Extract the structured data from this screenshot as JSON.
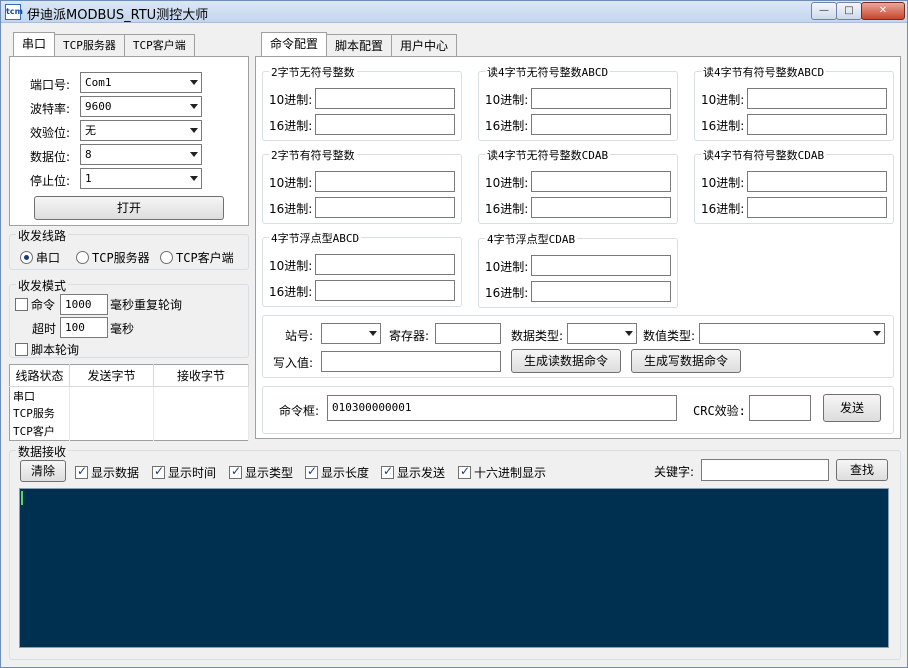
{
  "window": {
    "icon": "tcm-app-icon",
    "title": "伊迪派MODBUS_RTU测控大师",
    "buttons": {
      "minimize": "—",
      "maximize": "□",
      "close": "✕"
    }
  },
  "left_tabs": [
    "串口",
    "TCP服务器",
    "TCP客户端"
  ],
  "serial": {
    "port_label": "端口号:",
    "port_value": "Com1",
    "baud_label": "波特率:",
    "baud_value": "9600",
    "parity_label": "效验位:",
    "parity_value": "无",
    "databits_label": "数据位:",
    "databits_value": "8",
    "stopbits_label": "停止位:",
    "stopbits_value": "1",
    "open_button": "打开"
  },
  "route": {
    "title": "收发线路",
    "options": [
      "串口",
      "TCP服务器",
      "TCP客户端"
    ],
    "selected": 0
  },
  "mode": {
    "title": "收发模式",
    "cmd_label": "命令",
    "cmd_interval": "1000",
    "cmd_suffix": "毫秒重复轮询",
    "timeout_label": "超时",
    "timeout_value": "100",
    "timeout_suffix": "毫秒",
    "script_label": "脚本轮询"
  },
  "line_status": {
    "headers": [
      "线路状态",
      "发送字节",
      "接收字节"
    ],
    "rows": [
      "串口",
      "TCP服务",
      "TCP客户"
    ]
  },
  "right_tabs": [
    "命令配置",
    "脚本配置",
    "用户中心"
  ],
  "converters": {
    "dec_label": "10进制:",
    "hex_label": "16进制:",
    "groups": [
      "2字节无符号整数",
      "读4字节无符号整数ABCD",
      "读4字节有符号整数ABCD",
      "2字节有符号整数",
      "读4字节无符号整数CDAB",
      "读4字节有符号整数CDAB",
      "4字节浮点型ABCD",
      "4字节浮点型CDAB"
    ]
  },
  "command": {
    "station_label": "站号:",
    "register_label": "寄存器:",
    "datatype_label": "数据类型:",
    "valuetype_label": "数值类型:",
    "write_label": "写入值:",
    "gen_read_button": "生成读数据命令",
    "gen_write_button": "生成写数据命令",
    "cmd_box_label": "命令框:",
    "cmd_box_value": "010300000001",
    "crc_label": "CRC效验:",
    "send_button": "发送"
  },
  "receive": {
    "title": "数据接收",
    "clear_button": "清除",
    "options": [
      "显示数据",
      "显示时间",
      "显示类型",
      "显示长度",
      "显示发送",
      "十六进制显示"
    ],
    "keyword_label": "关键字:",
    "search_button": "查找"
  },
  "colors": {
    "console_bg": "#003050",
    "caret": "#5fd35f"
  }
}
